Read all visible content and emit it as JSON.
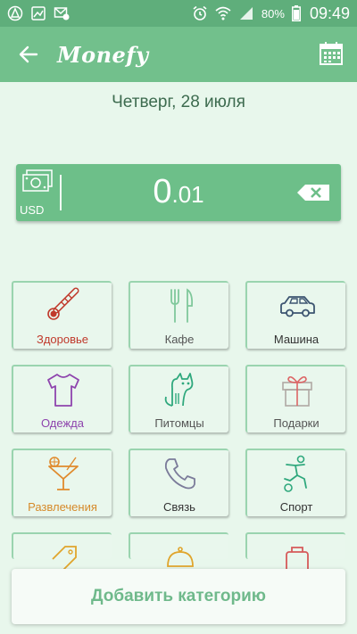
{
  "statusbar": {
    "battery": "80%",
    "time": "09:49"
  },
  "appbar": {
    "title": "Monefy"
  },
  "date": "Четверг, 28 июля",
  "amount": {
    "currency": "USD",
    "integer": "0",
    "decimal": ".01"
  },
  "categories": [
    {
      "label": "Здоровье",
      "icon": "thermometer-icon",
      "color": "#c0392b"
    },
    {
      "label": "Кафе",
      "icon": "fork-knife-icon",
      "color": "#555555"
    },
    {
      "label": "Машина",
      "icon": "car-icon",
      "color": "#333333"
    },
    {
      "label": "Одежда",
      "icon": "tshirt-icon",
      "color": "#8e44ad"
    },
    {
      "label": "Питомцы",
      "icon": "cat-icon",
      "color": "#555555"
    },
    {
      "label": "Подарки",
      "icon": "gift-icon",
      "color": "#555555"
    },
    {
      "label": "Развлечения",
      "icon": "cocktail-icon",
      "color": "#d68a2a"
    },
    {
      "label": "Связь",
      "icon": "phone-icon",
      "color": "#333333"
    },
    {
      "label": "Спорт",
      "icon": "sport-icon",
      "color": "#333333"
    }
  ],
  "add_category_label": "Добавить категорию",
  "colors": {
    "appbar": "#72c08c",
    "statusbar": "#5fae7b",
    "background": "#e8f7ec",
    "accent": "#6dbf89"
  }
}
